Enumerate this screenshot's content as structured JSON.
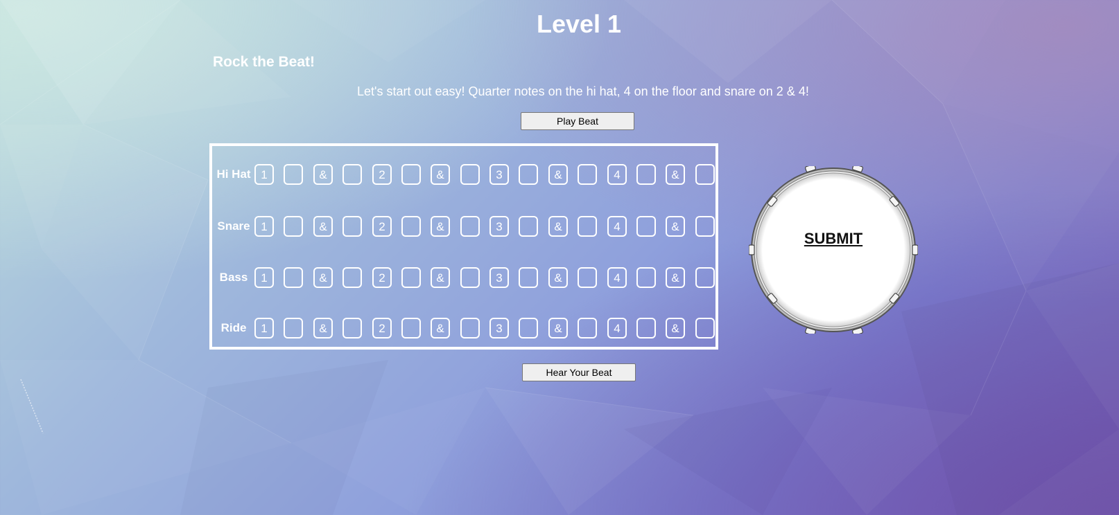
{
  "level": {
    "title": "Level 1"
  },
  "lesson": {
    "name": "Rock the Beat!",
    "instructions": "Let's start out easy! Quarter notes on the hi hat, 4 on the floor and snare on 2 & 4!"
  },
  "buttons": {
    "play": "Play Beat",
    "hear": "Hear Your Beat",
    "submit": "SUBMIT"
  },
  "sequencer": {
    "rows": [
      {
        "label": "Hi Hat"
      },
      {
        "label": "Snare"
      },
      {
        "label": "Bass"
      },
      {
        "label": "Ride"
      }
    ],
    "steps": [
      "1",
      "",
      "&",
      "",
      "2",
      "",
      "&",
      "",
      "3",
      "",
      "&",
      "",
      "4",
      "",
      "&",
      ""
    ]
  },
  "colors": {
    "text": "#ffffff",
    "grid_border": "#ffffff",
    "drum_head": "#ffffff",
    "submit_text": "#111111"
  }
}
